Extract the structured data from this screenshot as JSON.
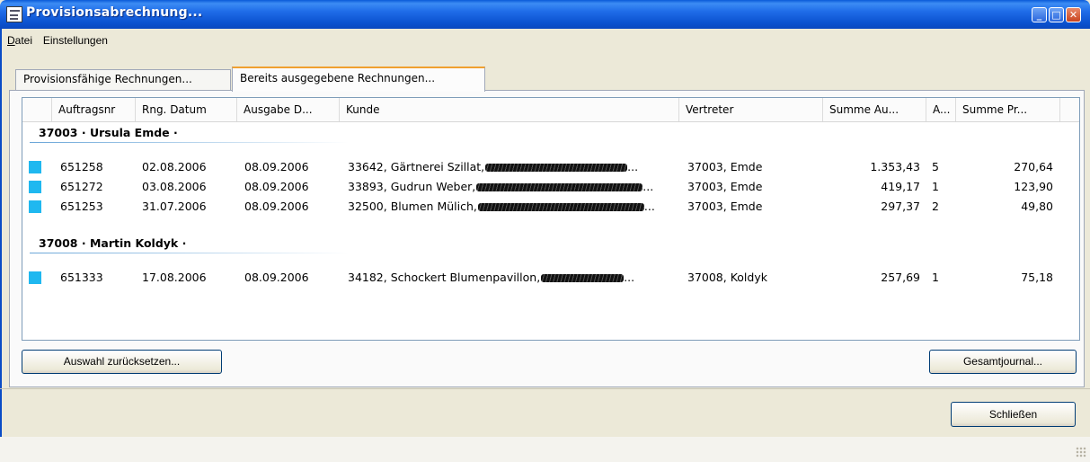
{
  "window": {
    "title": "Provisionsabrechnung...",
    "controls": {
      "minimize": "_",
      "maximize": "□",
      "close": "✕"
    }
  },
  "menu": [
    {
      "label": "Datei",
      "accel": "D",
      "rest": "atei"
    },
    {
      "label": "Einstellungen",
      "accel": "",
      "rest": "Einstellungen"
    }
  ],
  "tabs": [
    {
      "label": "Provisionsfähige Rechnungen...",
      "active": false
    },
    {
      "label": "Bereits ausgegebene Rechnungen...",
      "active": true
    }
  ],
  "table": {
    "columns": [
      "Auftragsnr",
      "Rng. Datum",
      "Ausgabe D...",
      "Kunde",
      "Vertreter",
      "Summe Au...",
      "A...",
      "Summe Pr..."
    ],
    "groups": [
      {
        "title": "37003 · Ursula Emde ·",
        "rows": [
          {
            "auftragsnr": "651258",
            "rng_datum": "02.08.2006",
            "ausgabe": "08.09.2006",
            "kunde": "33642, Gärtnerei Szillat,",
            "vertreter": "37003, Emde",
            "summe_au": "1.353,43",
            "a": "5",
            "summe_pr": "270,64"
          },
          {
            "auftragsnr": "651272",
            "rng_datum": "03.08.2006",
            "ausgabe": "08.09.2006",
            "kunde": "33893, Gudrun Weber,",
            "vertreter": "37003, Emde",
            "summe_au": "419,17",
            "a": "1",
            "summe_pr": "123,90"
          },
          {
            "auftragsnr": "651253",
            "rng_datum": "31.07.2006",
            "ausgabe": "08.09.2006",
            "kunde": "32500, Blumen Mülich,",
            "vertreter": "37003, Emde",
            "summe_au": "297,37",
            "a": "2",
            "summe_pr": "49,80"
          }
        ]
      },
      {
        "title": "37008 · Martin Koldyk ·",
        "rows": [
          {
            "auftragsnr": "651333",
            "rng_datum": "17.08.2006",
            "ausgabe": "08.09.2006",
            "kunde": "34182, Schockert  Blumenpavillon,",
            "vertreter": "37008, Koldyk",
            "summe_au": "257,69",
            "a": "1",
            "summe_pr": "75,18"
          }
        ]
      }
    ],
    "ellipsis": "..."
  },
  "buttons": {
    "reset": "Auswahl zurücksetzen...",
    "journal": "Gesamtjournal...",
    "close": "Schließen"
  },
  "colors": {
    "titlebar": "#0b52cf",
    "row_marker": "#1fb8f0",
    "active_tab_accent": "#f0a030"
  }
}
